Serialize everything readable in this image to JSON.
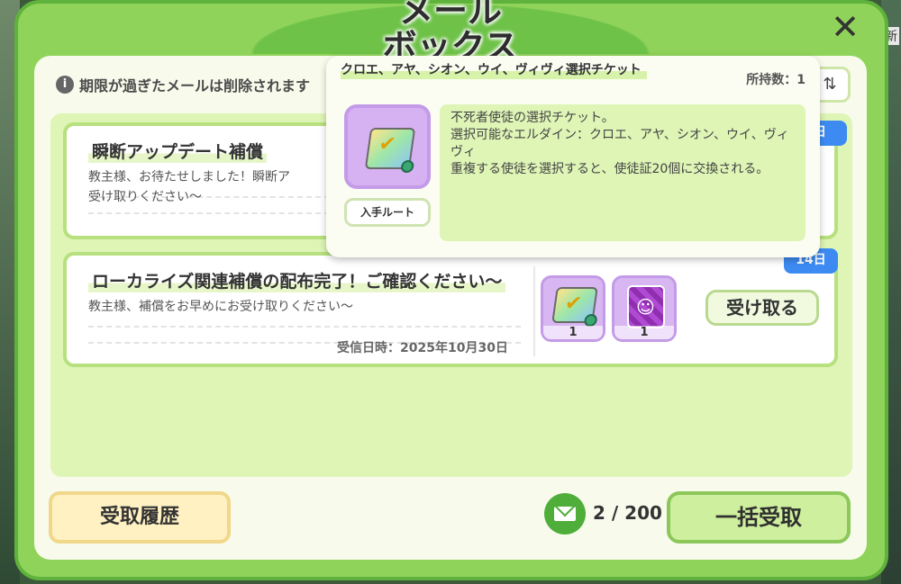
{
  "window": {
    "title": "メール\nボックス",
    "close_icon": "✕"
  },
  "notice": {
    "text": "期限が過ぎたメールは削除されます"
  },
  "mails": [
    {
      "title": "瞬断アップデート補償",
      "body": "教主様、お待たせしました！瞬断ア",
      "body_line2": "受け取りください～",
      "badge": "日"
    },
    {
      "title": "ローカライズ関連補償の配布完了！ご確認ください～",
      "body": "教主様、補償をお早めにお受け取りください～",
      "date": "受信日時：2025年10月30日",
      "badge": "14日",
      "items": [
        {
          "icon": "selection-ticket-icon",
          "qty": "1"
        },
        {
          "icon": "purple-card-icon",
          "qty": "1"
        }
      ],
      "receive_label": "受け取る"
    }
  ],
  "popup": {
    "title": "クロエ、アヤ、シオン、ウイ、ヴィヴィ選択チケット",
    "owned": "所持数：1",
    "route_label": "入手ルート",
    "desc_line1": "不死者使徒の選択チケット。",
    "desc_line2": "選択可能なエルダイン：クロエ、アヤ、シオン、ウイ、ヴィヴィ",
    "desc_line3": "重複する使徒を選択すると、使徒証20個に交換される。"
  },
  "footer": {
    "history_label": "受取履歴",
    "mail_count": "2 / 200",
    "bulk_label": "一括受取"
  },
  "background": {
    "right_edge_text": "新"
  },
  "colors": {
    "frame": "#8fd35a",
    "panel": "#def5b6",
    "badge_blue": "#3d8bf2",
    "item_purple": "#d8b6f2",
    "history_yellow": "#fff1c2",
    "bulk_green": "#cdef9e"
  }
}
